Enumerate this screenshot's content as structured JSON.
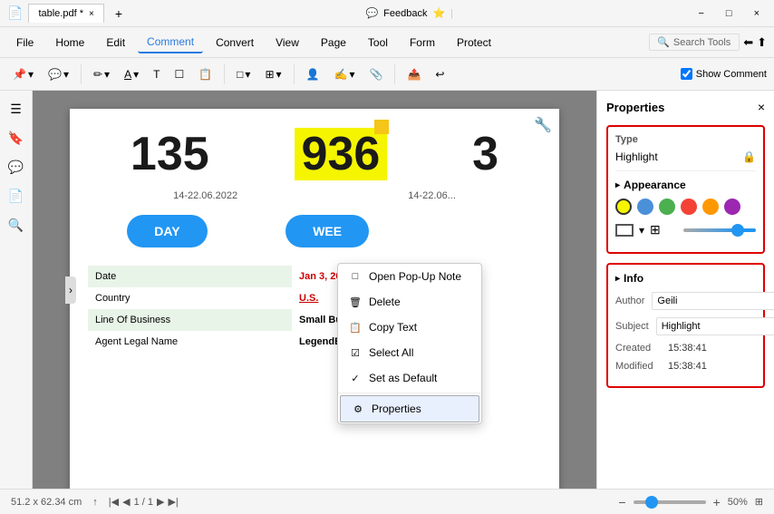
{
  "titlebar": {
    "tab_label": "table.pdf *",
    "close_tab": "×",
    "new_tab": "+",
    "feedback": "Feedback",
    "min": "−",
    "max": "□",
    "close": "×"
  },
  "menubar": {
    "items": [
      "File",
      "Home",
      "Edit",
      "Comment",
      "Convert",
      "View",
      "Page",
      "Tool",
      "Form",
      "Protect"
    ],
    "active": "Comment",
    "search_placeholder": "Search Tools",
    "show_comment": "Show Comment"
  },
  "toolbar": {
    "buttons": [
      "✏",
      "▼",
      "📌",
      "▼",
      "✏️",
      "A̲",
      "▼",
      "☐",
      "▼",
      "✎",
      "▼",
      "🖋",
      "⊞",
      "👤",
      "👤▼",
      "✂",
      "🔗",
      "✉",
      "📋"
    ]
  },
  "sidebar": {
    "icons": [
      "☰",
      "🔖",
      "💬",
      "📄",
      "🔍"
    ]
  },
  "pdf": {
    "number1": "135",
    "number2": "936",
    "number3": "3",
    "date1": "14-22.06.2022",
    "date2": "14-22.06...",
    "btn_day": "DAY",
    "btn_week": "WEE",
    "table": {
      "rows": [
        {
          "label": "Date",
          "value": "Jan 3, 2022",
          "highlight": true
        },
        {
          "label": "Country",
          "value": "U.S."
        },
        {
          "label": "Line Of Business",
          "value": "Small Business Banking",
          "highlight": true
        },
        {
          "label": "Agent Legal Name",
          "value": "LegendBusiness"
        }
      ]
    }
  },
  "context_menu": {
    "items": [
      {
        "icon": "□",
        "label": "Open Pop-Up Note"
      },
      {
        "icon": "🗑",
        "label": "Delete"
      },
      {
        "icon": "📋",
        "label": "Copy Text"
      },
      {
        "icon": "☑",
        "label": "Select All"
      },
      {
        "icon": "✓",
        "label": "Set as Default"
      },
      {
        "icon": "⚙",
        "label": "Properties",
        "selected": true
      }
    ]
  },
  "properties_panel": {
    "title": "Properties",
    "close": "×",
    "type_label": "Type",
    "type_value": "Highlight",
    "lock_icon": "🔒",
    "appearance_label": "Appearance",
    "colors": [
      "#f5f500",
      "#4a90d9",
      "#4caf50",
      "#f44336",
      "#ff9800",
      "#9c27b0"
    ],
    "info_label": "Info",
    "author_label": "Author",
    "author_value": "Geili",
    "subject_label": "Subject",
    "subject_value": "Highlight",
    "created_label": "Created",
    "created_value": "15:38:41",
    "modified_label": "Modified",
    "modified_value": "15:38:41"
  },
  "statusbar": {
    "dimensions": "51.2 x 62.34 cm",
    "page": "1 / 1",
    "zoom": "50%",
    "zoom_min_icon": "−",
    "zoom_max_icon": "+"
  }
}
